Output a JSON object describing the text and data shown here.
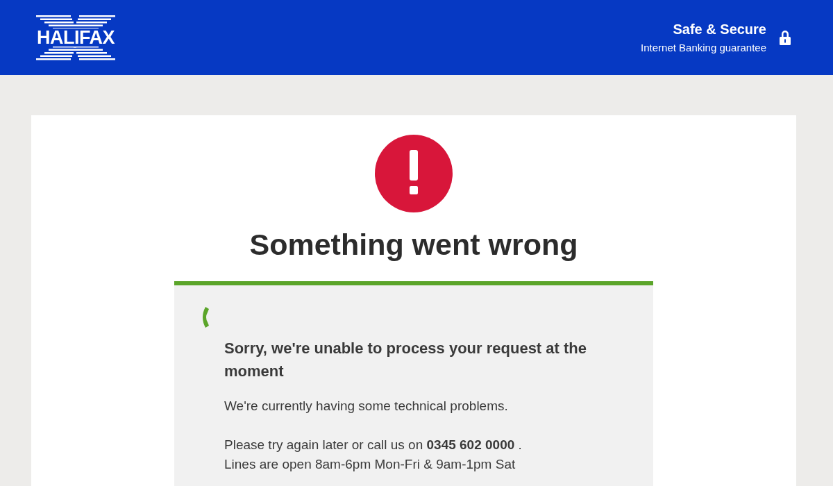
{
  "header": {
    "logo": "HALIFAX",
    "guarantee_title": "Safe & Secure",
    "guarantee_subtitle": "Internet Banking guarantee"
  },
  "error": {
    "heading": "Something went wrong"
  },
  "message": {
    "title": "Sorry, we're unable to process your request at the moment",
    "paragraphs": [
      "We're currently having some technical problems.",
      "Please try again later or call us on **0345 602 0000** .",
      "Lines are open 8am-6pm Mon-Fri & 9am-1pm Sat"
    ]
  }
}
